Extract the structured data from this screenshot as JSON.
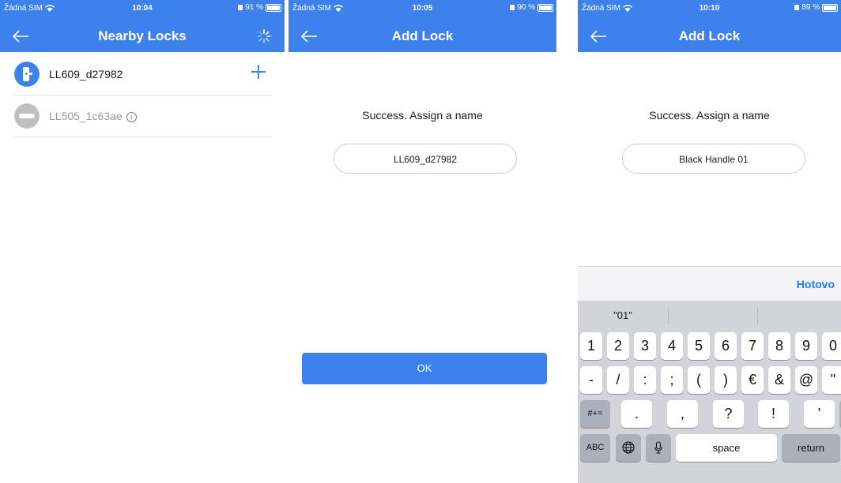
{
  "screens": [
    {
      "status": {
        "carrier": "Žádná SIM",
        "time": "10:04",
        "battery": "91 %",
        "battery_level": 0.91
      },
      "title": "Nearby Locks",
      "locks": [
        {
          "name": "LL609_d27982",
          "available": true
        },
        {
          "name": "LL505_1c63ae",
          "available": false
        }
      ]
    },
    {
      "status": {
        "carrier": "Žádná SIM",
        "time": "10:05",
        "battery": "90 %",
        "battery_level": 0.9
      },
      "title": "Add Lock",
      "prompt": "Success. Assign a name",
      "name_value": "LL609_d27982",
      "ok_label": "OK"
    },
    {
      "status": {
        "carrier": "Žádná SIM",
        "time": "10:10",
        "battery": "89 %",
        "battery_level": 0.89
      },
      "title": "Add Lock",
      "prompt": "Success. Assign a name",
      "name_value": "Black Handle 01",
      "keyboard": {
        "done_label": "Hotovo",
        "suggestions": [
          "\"01\"",
          "",
          ""
        ],
        "row1": [
          "1",
          "2",
          "3",
          "4",
          "5",
          "6",
          "7",
          "8",
          "9",
          "0"
        ],
        "row2": [
          "-",
          "/",
          ":",
          ";",
          "(",
          ")",
          "€",
          "&",
          "@",
          "\""
        ],
        "row3": [
          ".",
          ",",
          "?",
          "!",
          "'"
        ],
        "symbols_key": "#+=",
        "abc_key": "ABC",
        "space_label": "space",
        "return_label": "return"
      }
    }
  ],
  "colors": {
    "brand": "#3d82ec",
    "done": "#1a7cf5"
  },
  "icons": {
    "back": "arrow-left-icon",
    "spinner": "spinner-icon",
    "add": "plus-icon",
    "info": "info-icon",
    "globe": "globe-icon",
    "mic": "microphone-icon",
    "backspace": "backspace-icon"
  }
}
